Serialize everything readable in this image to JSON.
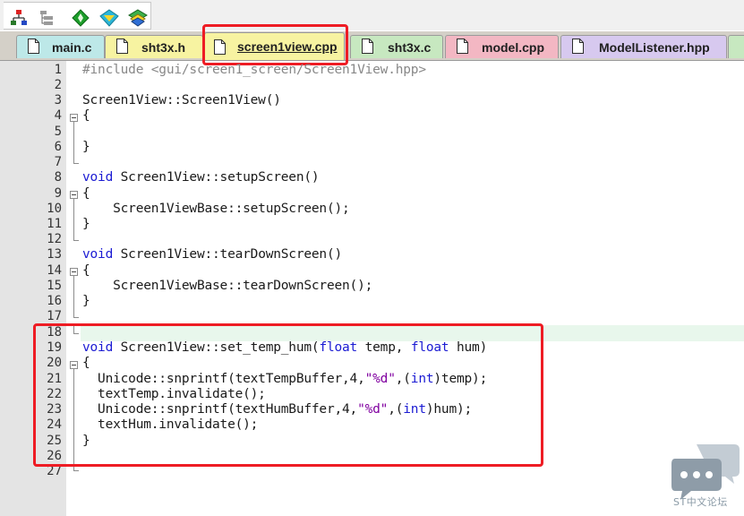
{
  "toolbar": {
    "icons": [
      "hierarchy-icon",
      "tree-list-icon",
      "diamond-nav-icon",
      "diamond-funnel-icon",
      "stack-layers-icon"
    ]
  },
  "tabs": [
    {
      "label": "main.c",
      "color": "#bde8e8",
      "active": false
    },
    {
      "label": "sht3x.h",
      "color": "#f7f3a1",
      "active": false
    },
    {
      "label": "screen1view.cpp",
      "color": "#f7f3a1",
      "active": true
    },
    {
      "label": "sht3x.c",
      "color": "#c7e8c0",
      "active": false
    },
    {
      "label": "model.cpp",
      "color": "#f3b7c3",
      "active": false
    },
    {
      "label": "ModelListener.hpp",
      "color": "#d7c9ef",
      "active": false
    },
    {
      "label": "",
      "color": "#c7e8c0",
      "active": false
    }
  ],
  "line_numbers": [
    "1",
    "2",
    "3",
    "4",
    "5",
    "6",
    "7",
    "8",
    "9",
    "10",
    "11",
    "12",
    "13",
    "14",
    "15",
    "16",
    "17",
    "18",
    "19",
    "20",
    "21",
    "22",
    "23",
    "24",
    "25",
    "26",
    "27"
  ],
  "code": {
    "l1_kw": "#include ",
    "l1_inc": "<gui/screen1_screen/Screen1View.hpp>",
    "l3": "Screen1View::Screen1View()",
    "l4": "{",
    "l6": "}",
    "l8_kw": "void",
    "l8_rest": " Screen1View::setupScreen()",
    "l9": "{",
    "l10": "    Screen1ViewBase::setupScreen();",
    "l11": "}",
    "l13_kw": "void",
    "l13_rest": " Screen1View::tearDownScreen()",
    "l14": "{",
    "l15": "    Screen1ViewBase::tearDownScreen();",
    "l16": "}",
    "l19_kw": "void",
    "l19_a": " Screen1View::set_temp_hum(",
    "l19_kw2": "float",
    "l19_b": " temp, ",
    "l19_kw3": "float",
    "l19_c": " hum)",
    "l20": "{",
    "l21_a": "  Unicode::snprintf(textTempBuffer,4,",
    "l21_str": "\"%d\"",
    "l21_b": ",(",
    "l21_kw": "int",
    "l21_c": ")temp);",
    "l22": "  textTemp.invalidate();",
    "l23_a": "  Unicode::snprintf(textHumBuffer,4,",
    "l23_str": "\"%d\"",
    "l23_b": ",(",
    "l23_kw": "int",
    "l23_c": ")hum);",
    "l24": "  textHum.invalidate();",
    "l25": "}"
  },
  "watermark": {
    "text": "ST中文论坛"
  },
  "colors": {
    "highlight": "#ee1c24",
    "keyword": "#1b1bd3",
    "string": "#8000a0"
  }
}
